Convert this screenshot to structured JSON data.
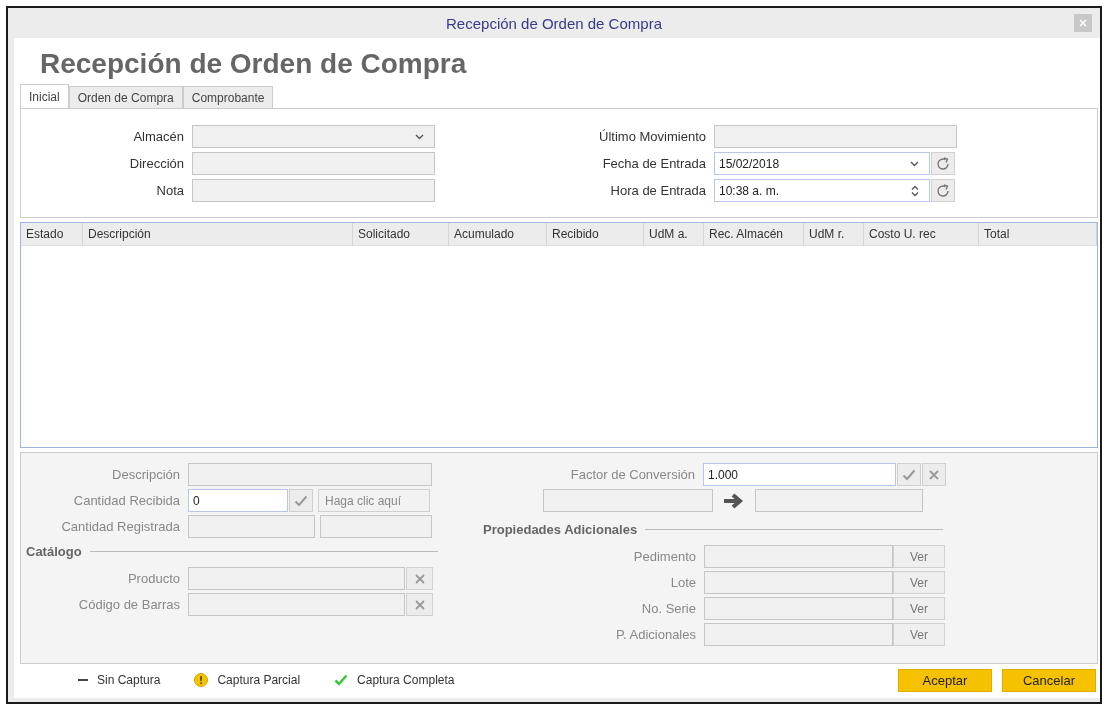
{
  "window": {
    "title": "Recepción de Orden de Compra"
  },
  "heading": "Recepción de Orden de Compra",
  "tabs": [
    {
      "label": "Inicial",
      "selected": true
    },
    {
      "label": "Orden de Compra",
      "selected": false
    },
    {
      "label": "Comprobante",
      "selected": false
    }
  ],
  "form": {
    "left": [
      {
        "label": "Almacén",
        "kind": "dropdown"
      },
      {
        "label": "Dirección",
        "kind": "text"
      },
      {
        "label": "Nota",
        "kind": "text"
      }
    ],
    "right": [
      {
        "label": "Último Movimiento",
        "kind": "text"
      },
      {
        "label": "Fecha de Entrada",
        "kind": "date",
        "value": "15/02/2018"
      },
      {
        "label": "Hora de Entrada",
        "kind": "time",
        "value": "10:38 a. m."
      }
    ]
  },
  "table": {
    "columns": [
      "Estado",
      "Descripción",
      "Solicitado",
      "Acumulado",
      "Recibido",
      "UdM a.",
      "Rec. Almacén",
      "UdM r.",
      "Costo U. rec",
      "Total"
    ]
  },
  "detail": {
    "disabled": true,
    "descripcion_label": "Descripción",
    "cantidad_recibida": {
      "label": "Cantidad Recibida",
      "value": "0",
      "link": "Haga clic aquí"
    },
    "cantidad_registrada_label": "Cantidad Registrada",
    "catalogo": {
      "title": "Catálogo",
      "fields": [
        {
          "label": "Producto"
        },
        {
          "label": "Código de Barras"
        }
      ]
    },
    "factor": {
      "label": "Factor de Conversión",
      "value": "1.000"
    },
    "propiedades": {
      "title": "Propiedades Adicionales",
      "fields": [
        {
          "label": "Pedimento",
          "button": "Ver"
        },
        {
          "label": "Lote",
          "button": "Ver"
        },
        {
          "label": "No. Serie",
          "button": "Ver"
        },
        {
          "label": "P. Adicionales",
          "button": "Ver"
        }
      ]
    }
  },
  "legend": [
    {
      "kind": "dash",
      "label": "Sin Captura"
    },
    {
      "kind": "warning",
      "label": "Captura Parcial"
    },
    {
      "kind": "check",
      "label": "Captura Completa"
    }
  ],
  "buttons": [
    "Aceptar",
    "Cancelar"
  ]
}
